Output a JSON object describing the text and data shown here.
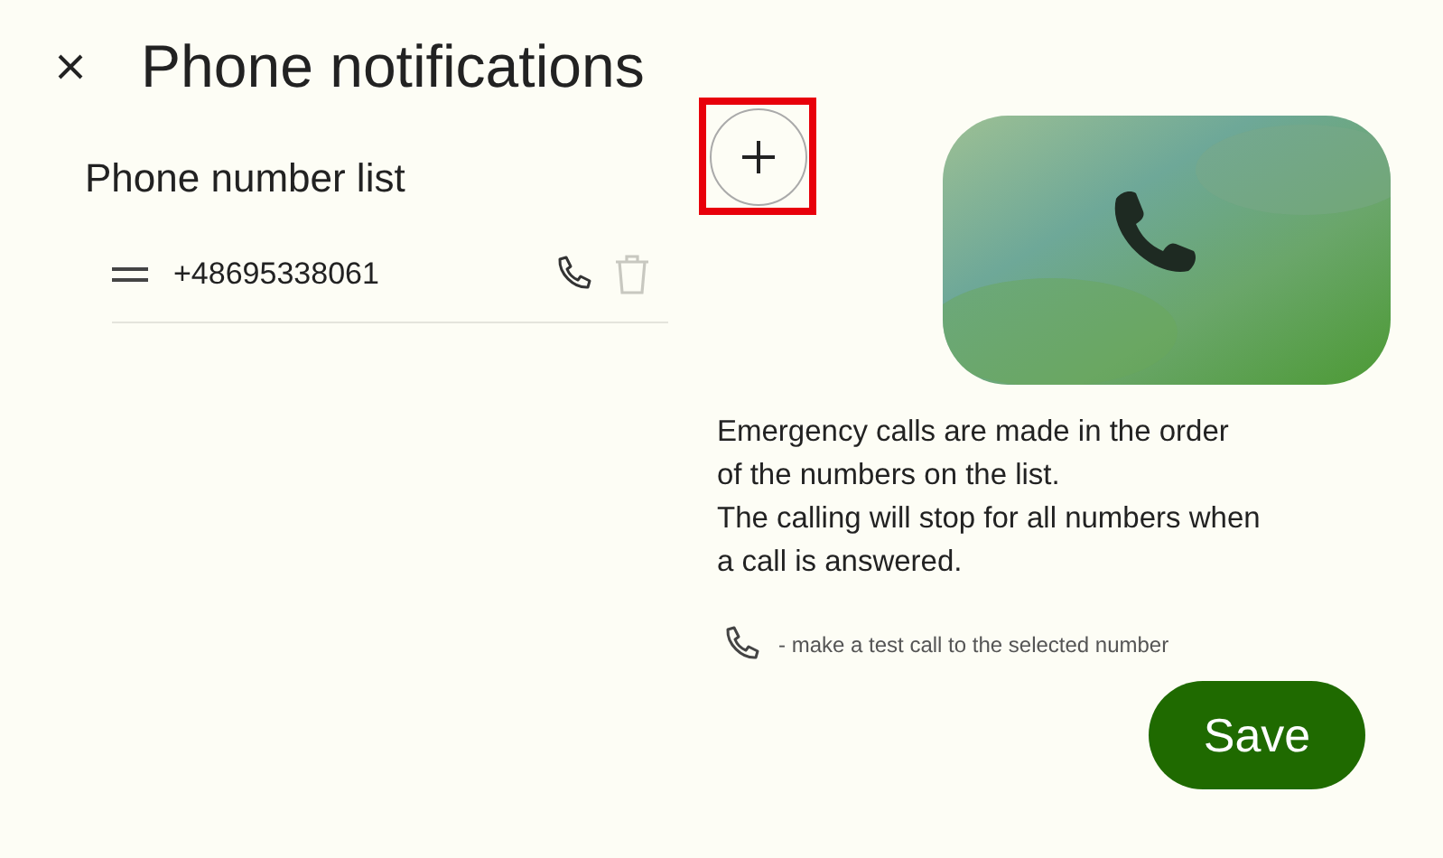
{
  "header": {
    "title": "Phone notifications"
  },
  "phone_list": {
    "title": "Phone number list",
    "add_button": {
      "highlighted": true
    },
    "items": [
      {
        "number": "+48695338061",
        "delete_disabled": true
      }
    ]
  },
  "info": {
    "lines": [
      "Emergency calls are made in the order",
      "of the numbers on the list.",
      "The calling will stop for all numbers when",
      "a call is answered."
    ],
    "hint": "- make a test call to the selected number"
  },
  "save_button": {
    "label": "Save"
  }
}
